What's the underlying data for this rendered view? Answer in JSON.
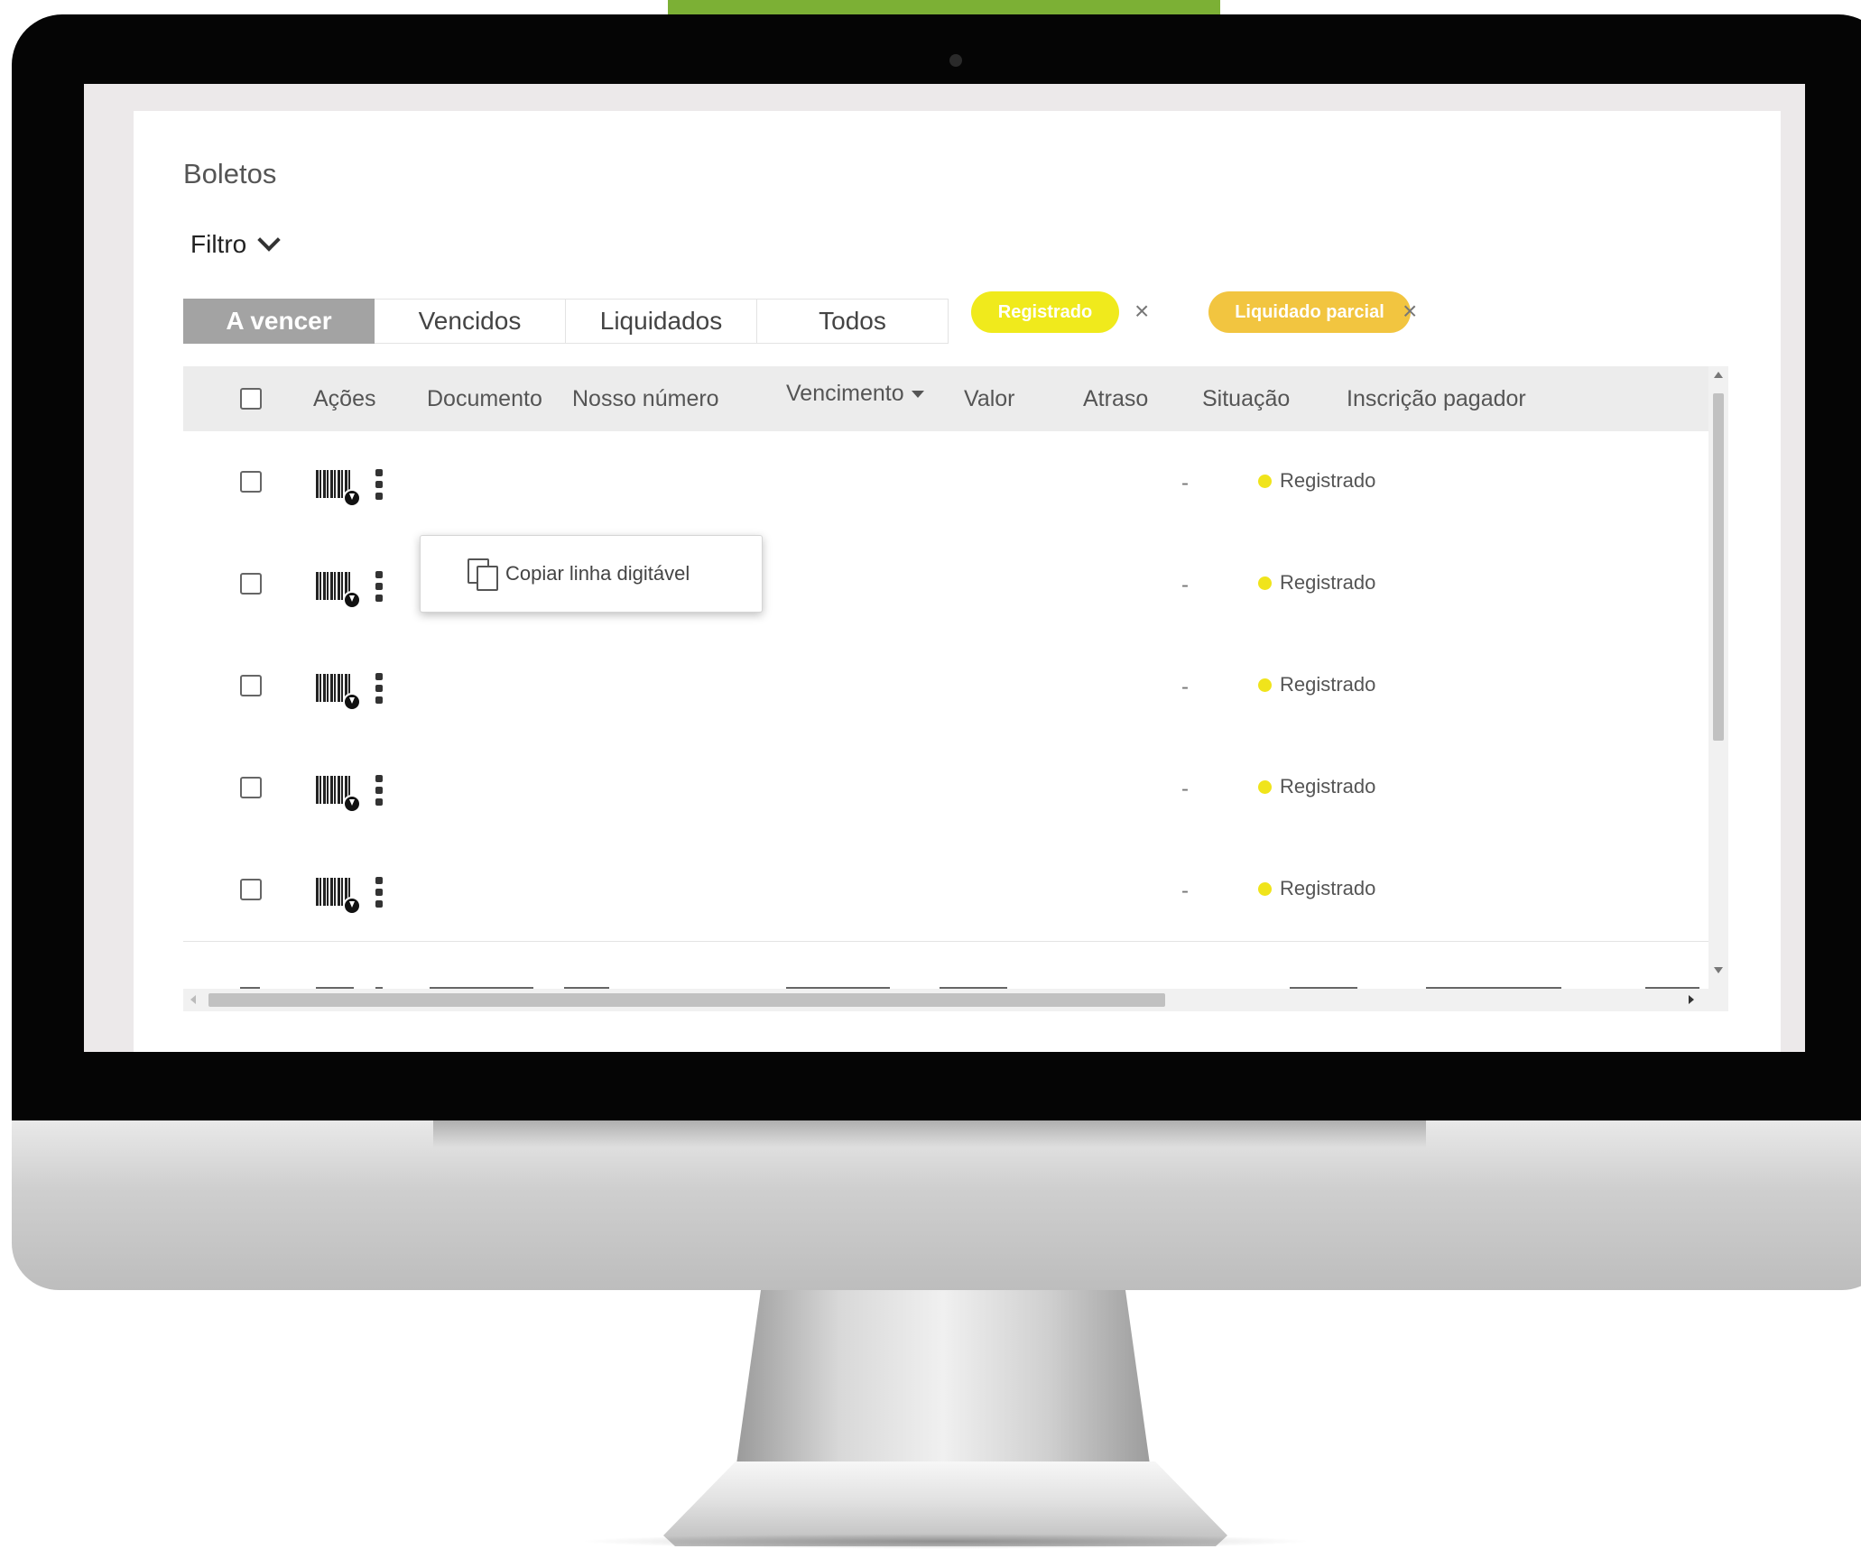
{
  "page": {
    "title": "Boletos",
    "filter_label": "Filtro"
  },
  "tabs": [
    {
      "label": "A vencer",
      "active": true
    },
    {
      "label": "Vencidos",
      "active": false
    },
    {
      "label": "Liquidados",
      "active": false
    },
    {
      "label": "Todos",
      "active": false
    }
  ],
  "filter_chips": [
    {
      "label": "Registrado",
      "color": "#f0ea1c",
      "remove_symbol": "×"
    },
    {
      "label": "Liquidado parcial",
      "color": "#f2c540",
      "remove_symbol": "×"
    }
  ],
  "table": {
    "columns": [
      "Ações",
      "Documento",
      "Nosso número",
      "Vencimento",
      "Valor",
      "Atraso",
      "Situação",
      "Inscrição pagador"
    ],
    "sorted_column": "Vencimento",
    "rows": [
      {
        "atraso": "-",
        "situacao": "Registrado"
      },
      {
        "atraso": "-",
        "situacao": "Registrado"
      },
      {
        "atraso": "-",
        "situacao": "Registrado"
      },
      {
        "atraso": "-",
        "situacao": "Registrado"
      },
      {
        "atraso": "-",
        "situacao": "Registrado"
      }
    ],
    "status_color": "#f0e41b"
  },
  "context_menu": {
    "item_label": "Copiar linha digitável",
    "icon": "copy-icon"
  },
  "colors": {
    "accent_green": "#7cb035",
    "active_tab": "#a3a3a3"
  }
}
